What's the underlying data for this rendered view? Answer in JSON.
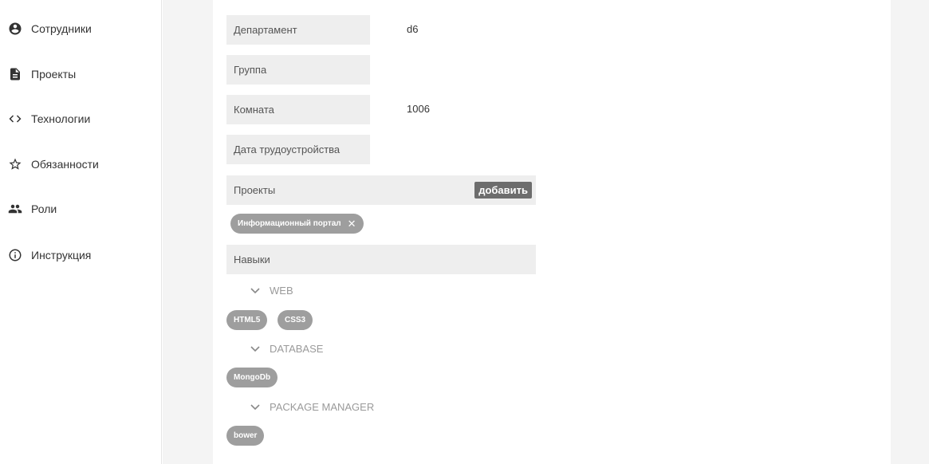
{
  "sidebar": {
    "items": [
      {
        "label": "Сотрудники",
        "icon": "account-circle-icon"
      },
      {
        "label": "Проекты",
        "icon": "document-icon"
      },
      {
        "label": "Технологии",
        "icon": "code-icon"
      },
      {
        "label": "Обязанности",
        "icon": "star-outline-icon"
      },
      {
        "label": "Роли",
        "icon": "people-icon"
      },
      {
        "label": "Инструкция",
        "icon": "info-outline-icon"
      }
    ]
  },
  "form": {
    "department": {
      "label": "Департамент",
      "value": "d6"
    },
    "group": {
      "label": "Группа",
      "value": ""
    },
    "room": {
      "label": "Комната",
      "value": "1006"
    },
    "hire_date": {
      "label": "Дата трудоустройства",
      "value": ""
    },
    "projects": {
      "label": "Проекты",
      "add_label": "добавить",
      "chips": [
        "Информационный портал"
      ]
    },
    "skills": {
      "label": "Навыки",
      "categories": [
        {
          "name": "WEB",
          "chips": [
            "HTML5",
            "CSS3"
          ]
        },
        {
          "name": "DATABASE",
          "chips": [
            "MongoDb"
          ]
        },
        {
          "name": "PACKAGE MANAGER",
          "chips": [
            "bower"
          ]
        }
      ]
    }
  },
  "colors": {
    "field_bg": "#eeeeee",
    "chip_bg": "#9e9e9e",
    "button_bg": "#6d6d6d",
    "gutter_bg": "#f4f4f4"
  }
}
